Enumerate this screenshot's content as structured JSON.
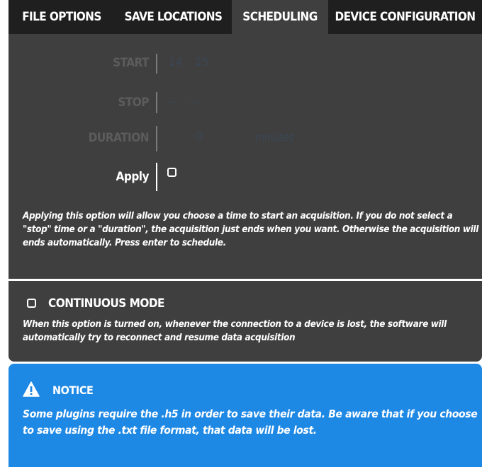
{
  "tabs": [
    {
      "label": "FILE OPTIONS"
    },
    {
      "label": "SAVE LOCATIONS"
    },
    {
      "label": "SCHEDULING"
    },
    {
      "label": "DEVICE CONFIGURATION"
    }
  ],
  "scheduling": {
    "start_label": "START",
    "start_value": "14 : 25",
    "stop_label": "STOP",
    "stop_value": "-- : --",
    "duration_label": "DURATION",
    "duration_value": "0",
    "duration_unit": "minutes",
    "apply_label": "Apply",
    "apply_checked": false,
    "description": "Applying this option will allow you choose a time to start an acquisition. If you do not select a \"stop\" time or a \"duration\", the acquisition just ends when you want. Otherwise the acquisition will ends automatically. Press enter to schedule."
  },
  "continuous_mode": {
    "title": "CONTINUOUS MODE",
    "checked": false,
    "description": "When this option is turned on, whenever the connection to a device is lost, the software will automatically try to reconnect and resume data acquisition"
  },
  "notice": {
    "icon": "warning-icon",
    "title": "NOTICE",
    "body": "Some plugins require the .h5 in order to save their data. Be aware that if you choose to save using the .txt file format, that data will be lost."
  },
  "colors": {
    "tab_bar": "#1f1f1f",
    "panel": "#3f3f3f",
    "notice": "#1e88e5",
    "disabled_text": "#5c5c5c",
    "disabled_value": "#3a4756"
  }
}
